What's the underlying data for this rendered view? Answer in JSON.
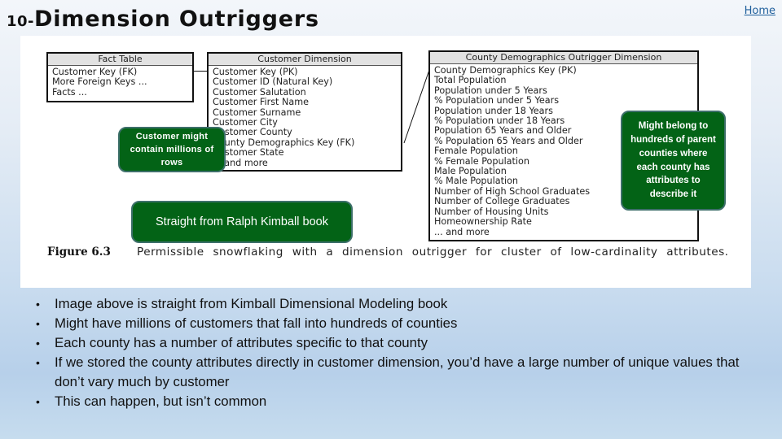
{
  "slide": {
    "number_prefix": "10-",
    "title": "Dimension Outriggers",
    "home_link": "Home"
  },
  "figure": {
    "fact_table": {
      "title": "Fact Table",
      "rows": [
        "Customer Key (FK)",
        "More Foreign Keys ...",
        "Facts ..."
      ]
    },
    "customer_dimension": {
      "title": "Customer Dimension",
      "rows": [
        "Customer Key (PK)",
        "Customer ID (Natural Key)",
        "Customer Salutation",
        "Customer First Name",
        "Customer Surname",
        "Customer City",
        "Customer County",
        "County Demographics Key (FK)",
        "Customer State",
        "... and more"
      ]
    },
    "county_outrigger": {
      "title": "County Demographics Outrigger Dimension",
      "rows": [
        "County Demographics Key (PK)",
        "Total Population",
        "Population under 5 Years",
        "% Population under 5 Years",
        "Population under 18 Years",
        "% Population under 18 Years",
        "Population 65 Years and Older",
        "% Population 65 Years and Older",
        "Female Population",
        "% Female Population",
        "Male Population",
        "% Male Population",
        "Number of High School Graduates",
        "Number of College Graduates",
        "Number of Housing Units",
        "Homeownership Rate",
        "... and more"
      ]
    },
    "callouts": {
      "customer": "Customer might contain millions of rows",
      "county": "Might belong to hundreds of parent counties where each county has attributes to describe it",
      "source": "Straight from Ralph Kimball book"
    },
    "caption": {
      "label": "Figure 6.3",
      "text": "Permissible snowflaking with a dimension outrigger for cluster of low-cardinality attributes."
    },
    "colors": {
      "callout_green": "#036316",
      "callout_border": "#3d6f6a",
      "link_blue": "#1f5f9c"
    }
  },
  "bullets": [
    "Image above is straight from Kimball Dimensional Modeling book",
    "Might have millions of customers that fall into hundreds of counties",
    "Each county has a number of attributes specific to that county",
    "If we stored the county attributes directly in customer dimension, you’d have a large number of unique values that don’t vary much by customer",
    "This can happen, but isn’t common"
  ]
}
